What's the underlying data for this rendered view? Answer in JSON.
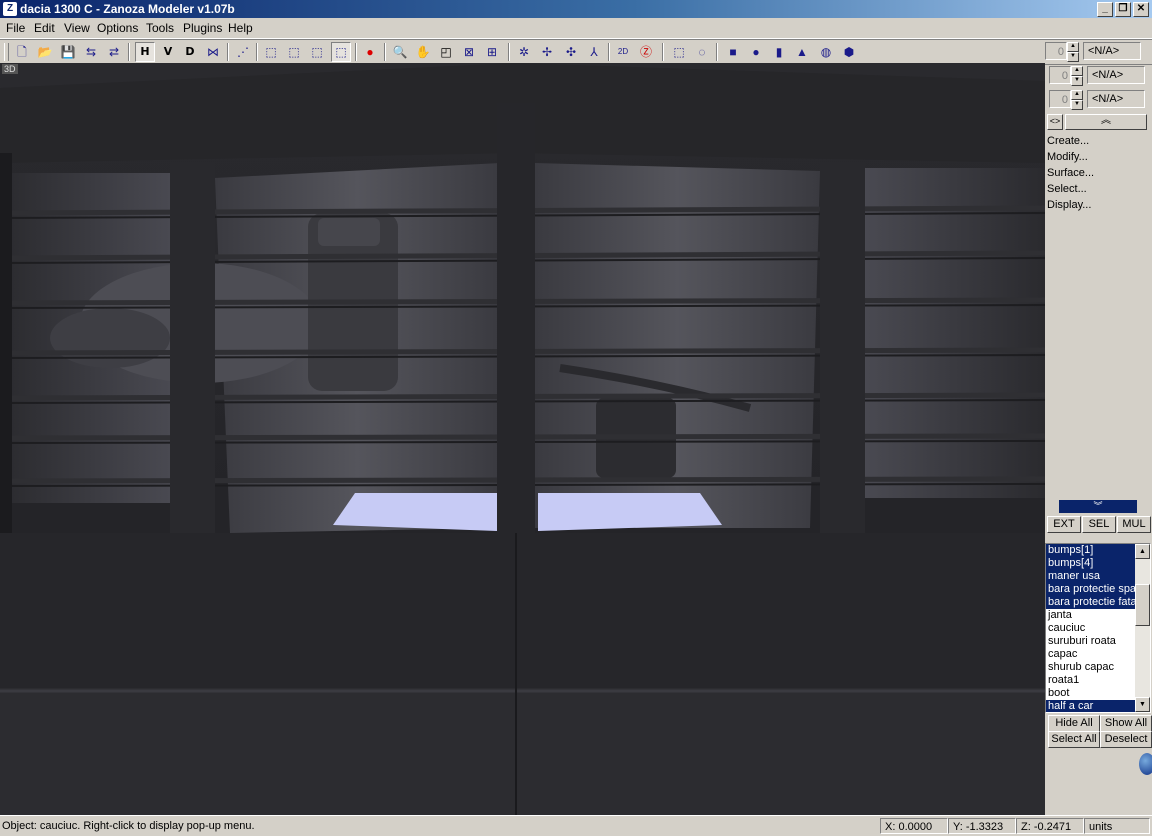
{
  "window": {
    "title": "dacia 1300 C - Zanoza Modeler v1.07b",
    "minimize": "_",
    "restore": "❐",
    "close": "✕"
  },
  "menu": [
    "File",
    "Edit",
    "View",
    "Options",
    "Tools",
    "Plugins",
    "Help"
  ],
  "toolbar": {
    "h_label": "H",
    "v_label": "V",
    "d_label": "D"
  },
  "spinners": [
    {
      "value": "0",
      "label": "<N/A>"
    },
    {
      "value": "0",
      "label": "<N/A>"
    },
    {
      "value": "0",
      "label": "<N/A>"
    }
  ],
  "viewport": {
    "label": "3D"
  },
  "panel": {
    "toggle": "<>",
    "collapse": "︽",
    "expand": "︾",
    "commands": [
      "Create...",
      "Modify...",
      "Surface...",
      "Select...",
      "Display..."
    ],
    "modes": [
      "EXT",
      "SEL",
      "MUL"
    ]
  },
  "objects": [
    {
      "name": "bumps[1]",
      "selected": true
    },
    {
      "name": "bumps[4]",
      "selected": true
    },
    {
      "name": "maner usa",
      "selected": true
    },
    {
      "name": "bara protectie spate",
      "selected": true
    },
    {
      "name": "bara protectie fata",
      "selected": true
    },
    {
      "name": "janta",
      "selected": false
    },
    {
      "name": "cauciuc",
      "selected": false
    },
    {
      "name": "suruburi roata",
      "selected": false
    },
    {
      "name": "capac",
      "selected": false
    },
    {
      "name": "shurub capac",
      "selected": false
    },
    {
      "name": "roata1",
      "selected": false
    },
    {
      "name": "boot",
      "selected": false
    },
    {
      "name": "half a car",
      "selected": true
    }
  ],
  "list_buttons": {
    "hide_all": "Hide All",
    "show_all": "Show All",
    "select_all": "Select All",
    "deselect": "Deselect"
  },
  "status": {
    "message": "Object: cauciuc. Right-click to display pop-up menu.",
    "x": "X: 0.0000",
    "y": "Y: -1.3323",
    "z": "Z: -0.2471",
    "units": "units"
  }
}
